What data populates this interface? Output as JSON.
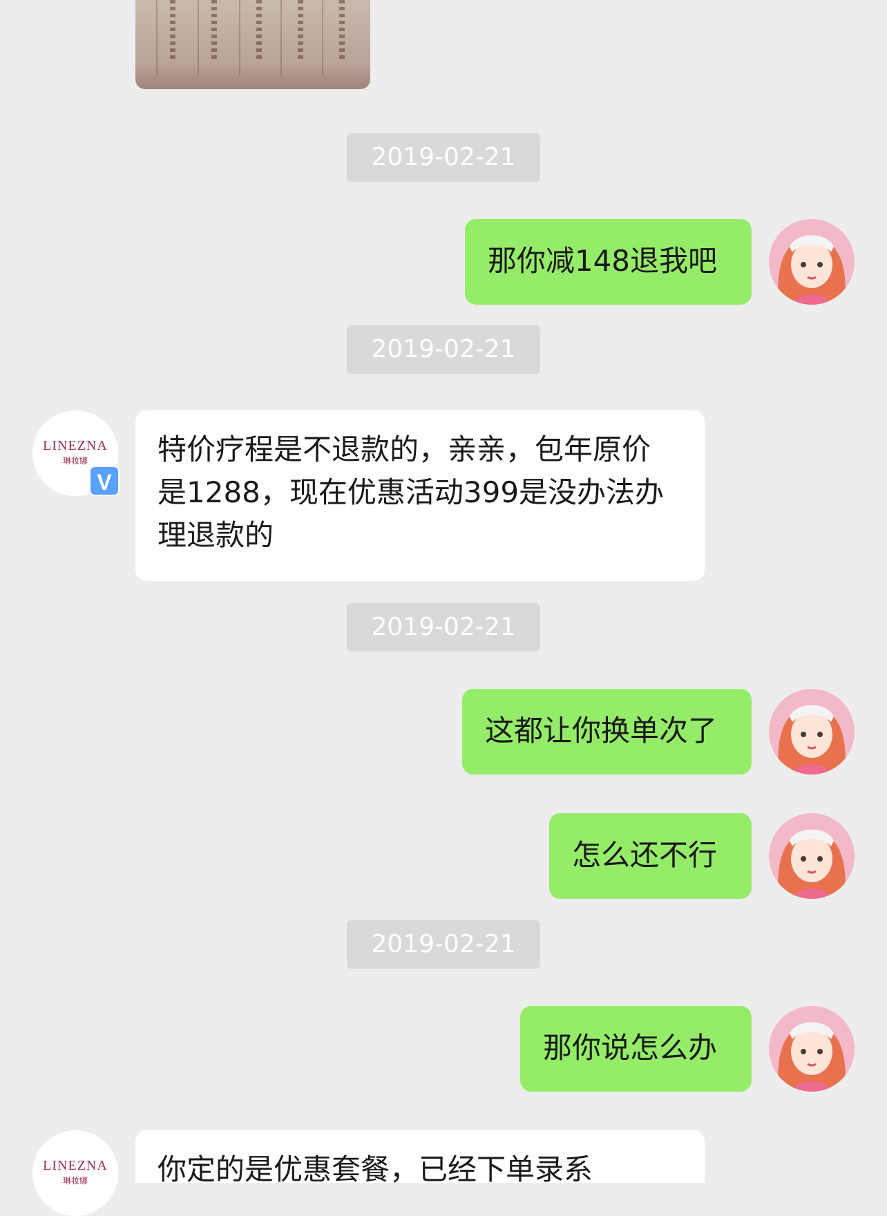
{
  "timestamps": [
    "2019-02-21",
    "2019-02-21",
    "2019-02-21",
    "2019-02-21"
  ],
  "messages": [
    {
      "side": "out",
      "text": "那你减148退我吧"
    },
    {
      "side": "in",
      "text": "特价疗程是不退款的，亲亲，包年原价是1288，现在优惠活动399是没办法办理退款的"
    },
    {
      "side": "out",
      "text": "这都让你换单次了"
    },
    {
      "side": "out",
      "text": "怎么还不行"
    },
    {
      "side": "out",
      "text": "那你说怎么办"
    },
    {
      "side": "in",
      "text": "你定的是优惠套餐，已经下单录系"
    }
  ],
  "shop": {
    "logo_text": "LINEZNA",
    "logo_sub": "琳妆娜",
    "verified_label": "V"
  },
  "colors": {
    "background": "#ededed",
    "outgoing_bubble": "#95ec69",
    "incoming_bubble": "#ffffff",
    "timestamp_bg": "#d9d9d9",
    "verified_badge": "#5aa2ff"
  },
  "icons": {
    "user_avatar": "cartoon-girl-avatar-icon",
    "shop_avatar": "linezna-logo-icon",
    "verified": "verified-badge-icon"
  }
}
